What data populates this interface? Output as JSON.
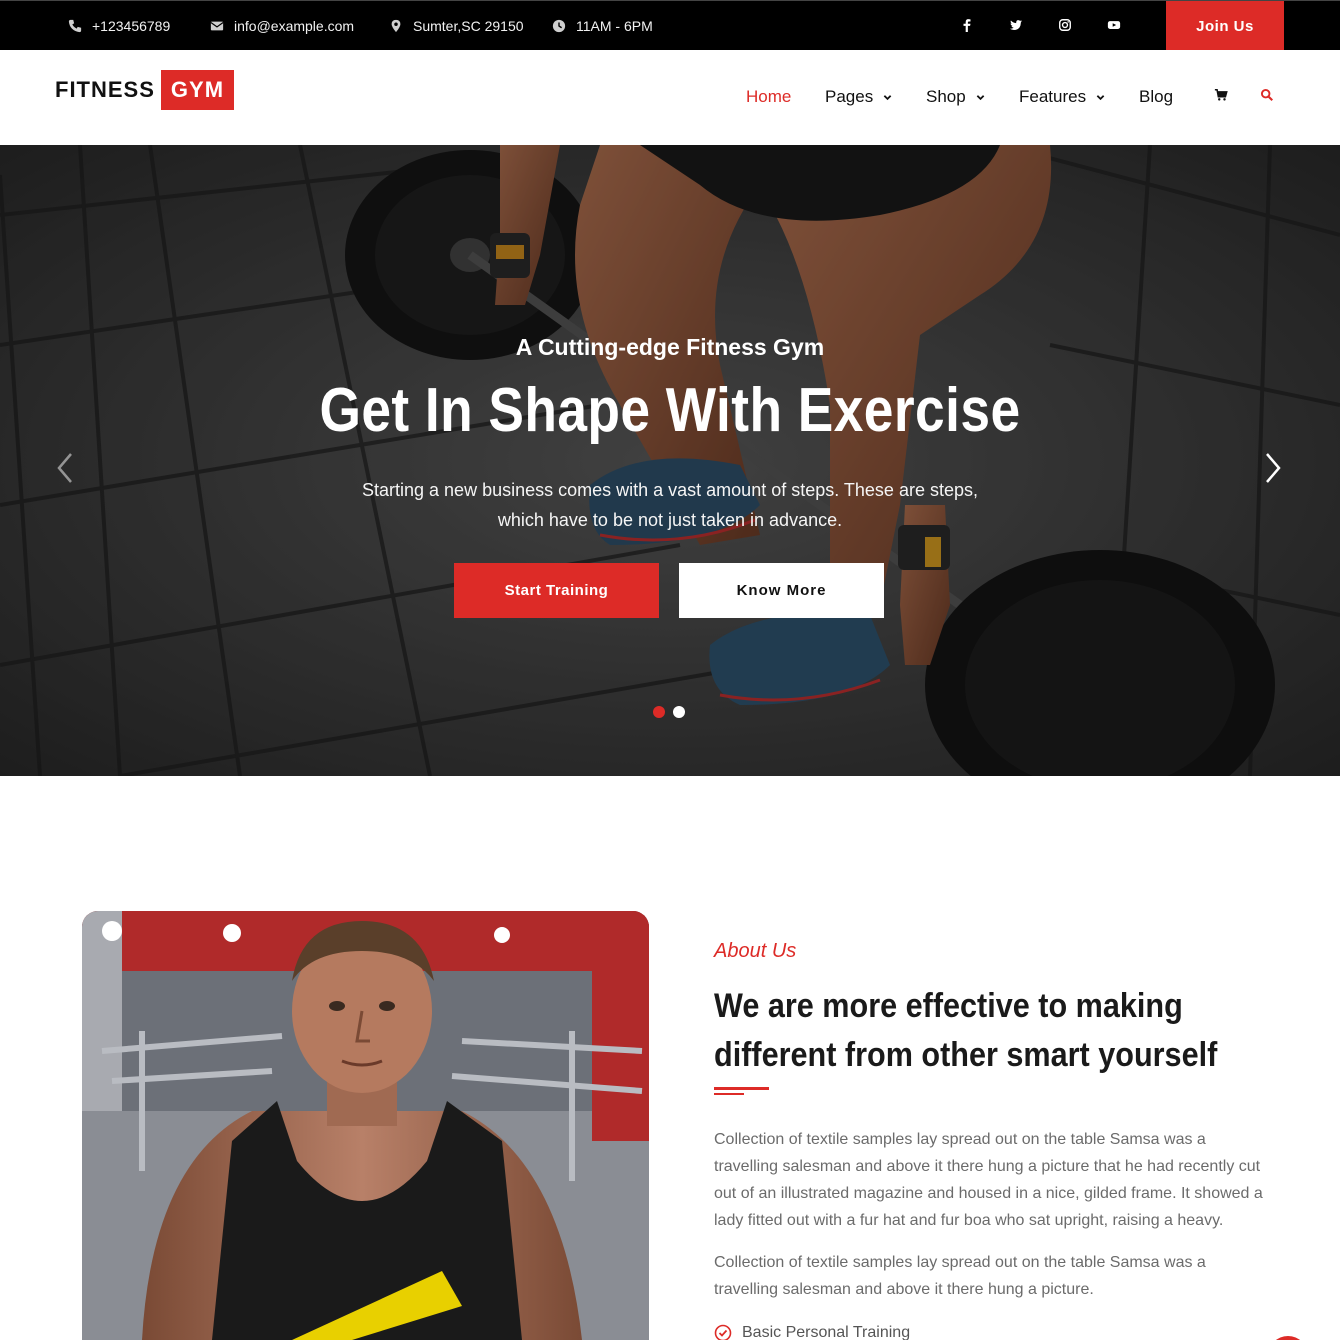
{
  "topbar": {
    "phone": "+123456789",
    "email": "info@example.com",
    "address": "Sumter,SC 29150",
    "hours": "11AM - 6PM",
    "social_icons": [
      "facebook-icon",
      "twitter-icon",
      "instagram-icon",
      "youtube-icon"
    ],
    "join_label": "Join Us"
  },
  "header": {
    "logo_word1": "FITNESS",
    "logo_word2": "GYM",
    "nav": [
      {
        "label": "Home",
        "active": true,
        "dropdown": false
      },
      {
        "label": "Pages",
        "active": false,
        "dropdown": true
      },
      {
        "label": "Shop",
        "active": false,
        "dropdown": true
      },
      {
        "label": "Features",
        "active": false,
        "dropdown": true
      },
      {
        "label": "Blog",
        "active": false,
        "dropdown": false
      }
    ],
    "icons": [
      "cart-icon",
      "search-icon"
    ]
  },
  "hero": {
    "subtitle": "A Cutting-edge Fitness Gym",
    "title": "Get In Shape With Exercise",
    "description": "Starting a new business comes with a vast amount of steps. These are steps, which have to be not just taken in advance.",
    "primary_button": "Start Training",
    "secondary_button": "Know More",
    "slide_count": 2,
    "active_slide": 1
  },
  "about": {
    "label": "About Us",
    "title": "We are more effective to making different from other smart yourself",
    "paragraph1": "Collection of textile samples lay spread out on the table Samsa was a travelling salesman and above it there hung a picture that he had recently cut out of an illustrated magazine and housed in a nice, gilded frame. It showed a lady fitted out with a fur hat and fur boa who sat upright, raising a heavy.",
    "paragraph2": "Collection of textile samples lay spread out on the table Samsa was a travelling salesman and above it there hung a picture.",
    "feature1": "Basic Personal Training"
  },
  "colors": {
    "accent": "#dd2b27",
    "topbar_bg": "#000000",
    "text_dark": "#1a1a1a",
    "text_muted": "#6b6b6b"
  }
}
